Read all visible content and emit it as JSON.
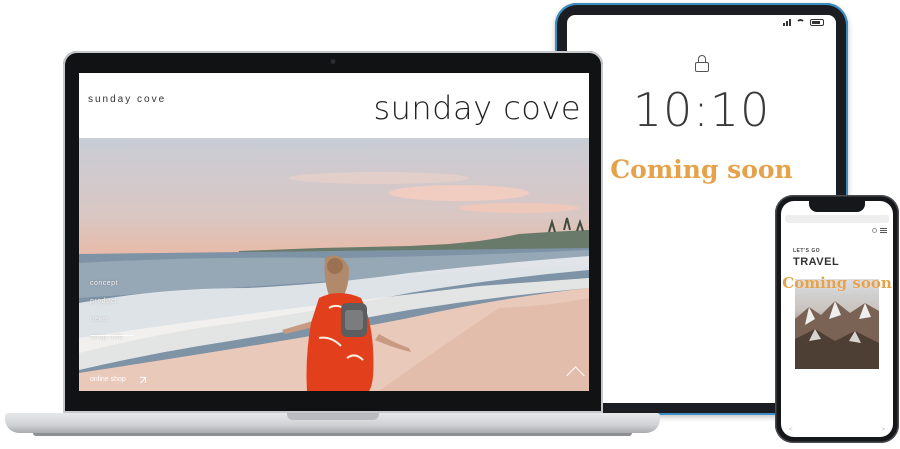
{
  "tablet": {
    "time": "10:10",
    "coming_soon": "Coming soon"
  },
  "laptop": {
    "logo_small": "sunday cove",
    "site_title": "sunday cove",
    "nav": [
      "concept",
      "product",
      "news",
      "shop info"
    ],
    "online_shop": "online shop"
  },
  "phone": {
    "small_heading": "LET'S GO",
    "big_heading": "TRAVEL",
    "coming_soon": "Coming soon",
    "nav_back": "<",
    "nav_forward": ">"
  },
  "colors": {
    "accent_coming_soon": "#e6a24b",
    "tablet_bezel": "#3a8ec4",
    "dress": "#e2401d"
  },
  "icons": [
    "lock-icon",
    "signal-icon",
    "wifi-icon",
    "battery-icon",
    "external-link-icon",
    "chevron-up-icon",
    "search-icon",
    "menu-icon"
  ]
}
